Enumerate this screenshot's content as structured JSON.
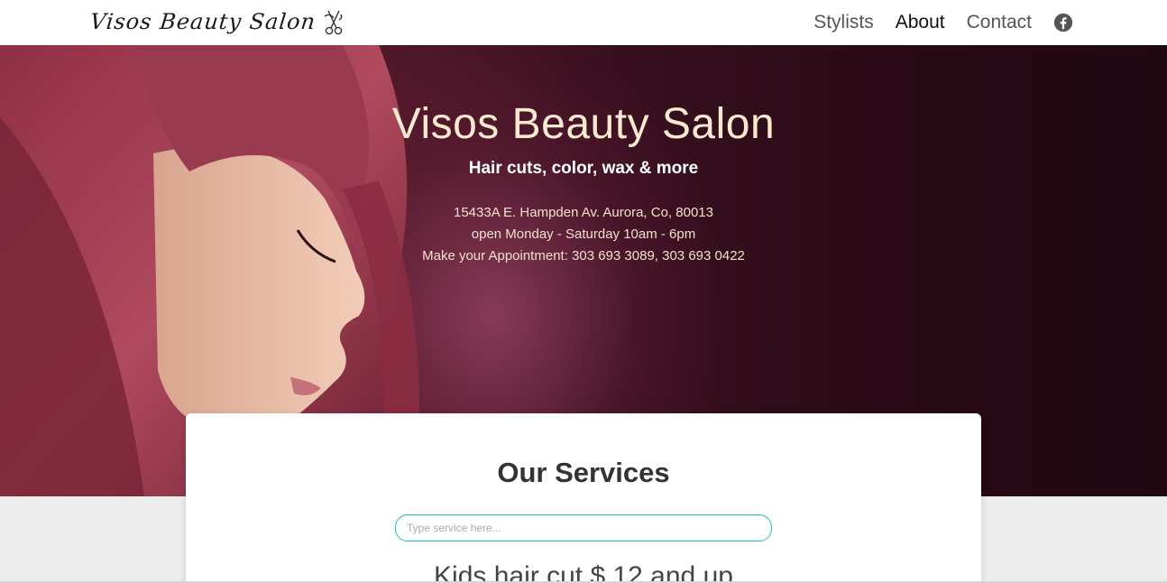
{
  "navbar": {
    "brand": "Visos Beauty Salon",
    "links": [
      {
        "label": "Stylists",
        "active": false
      },
      {
        "label": "About",
        "active": true
      },
      {
        "label": "Contact",
        "active": false
      }
    ],
    "social_icon": "facebook-icon"
  },
  "hero": {
    "title": "Visos Beauty Salon",
    "subtitle": "Hair cuts, color, wax & more",
    "address": "15433A E. Hampden Av. Aurora, Co, 80013",
    "hours": "open Monday - Saturday 10am - 6pm",
    "appointment": "Make your Appointment: 303 693 3089, 303 693 0422"
  },
  "services": {
    "title": "Our Services",
    "search_placeholder": "Type service here...",
    "items": [
      "Kids hair cut $ 12 and up"
    ]
  },
  "colors": {
    "accent": "#1fbfae",
    "hero_text": "#fbe9d0",
    "hero_bg": "#3a0e1c"
  }
}
